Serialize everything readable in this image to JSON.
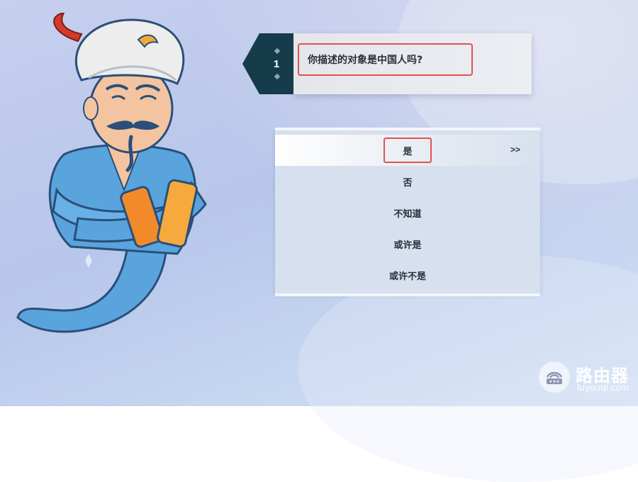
{
  "question": {
    "number": "1",
    "text": "你描述的对象是中国人吗?"
  },
  "answers": [
    {
      "label": "是"
    },
    {
      "label": "否"
    },
    {
      "label": "不知道"
    },
    {
      "label": "或许是"
    },
    {
      "label": "或许不是"
    }
  ],
  "selected_indicator": ">>",
  "watermark": {
    "title": "路由器",
    "subtitle": "luyouqi.com"
  },
  "colors": {
    "tab": "#163c4c",
    "highlight": "#e2524f",
    "robe": "#5aa4dd",
    "turban": "#ededed"
  },
  "icons": {
    "character": "genie-character",
    "watermark": "router-logo-icon"
  }
}
